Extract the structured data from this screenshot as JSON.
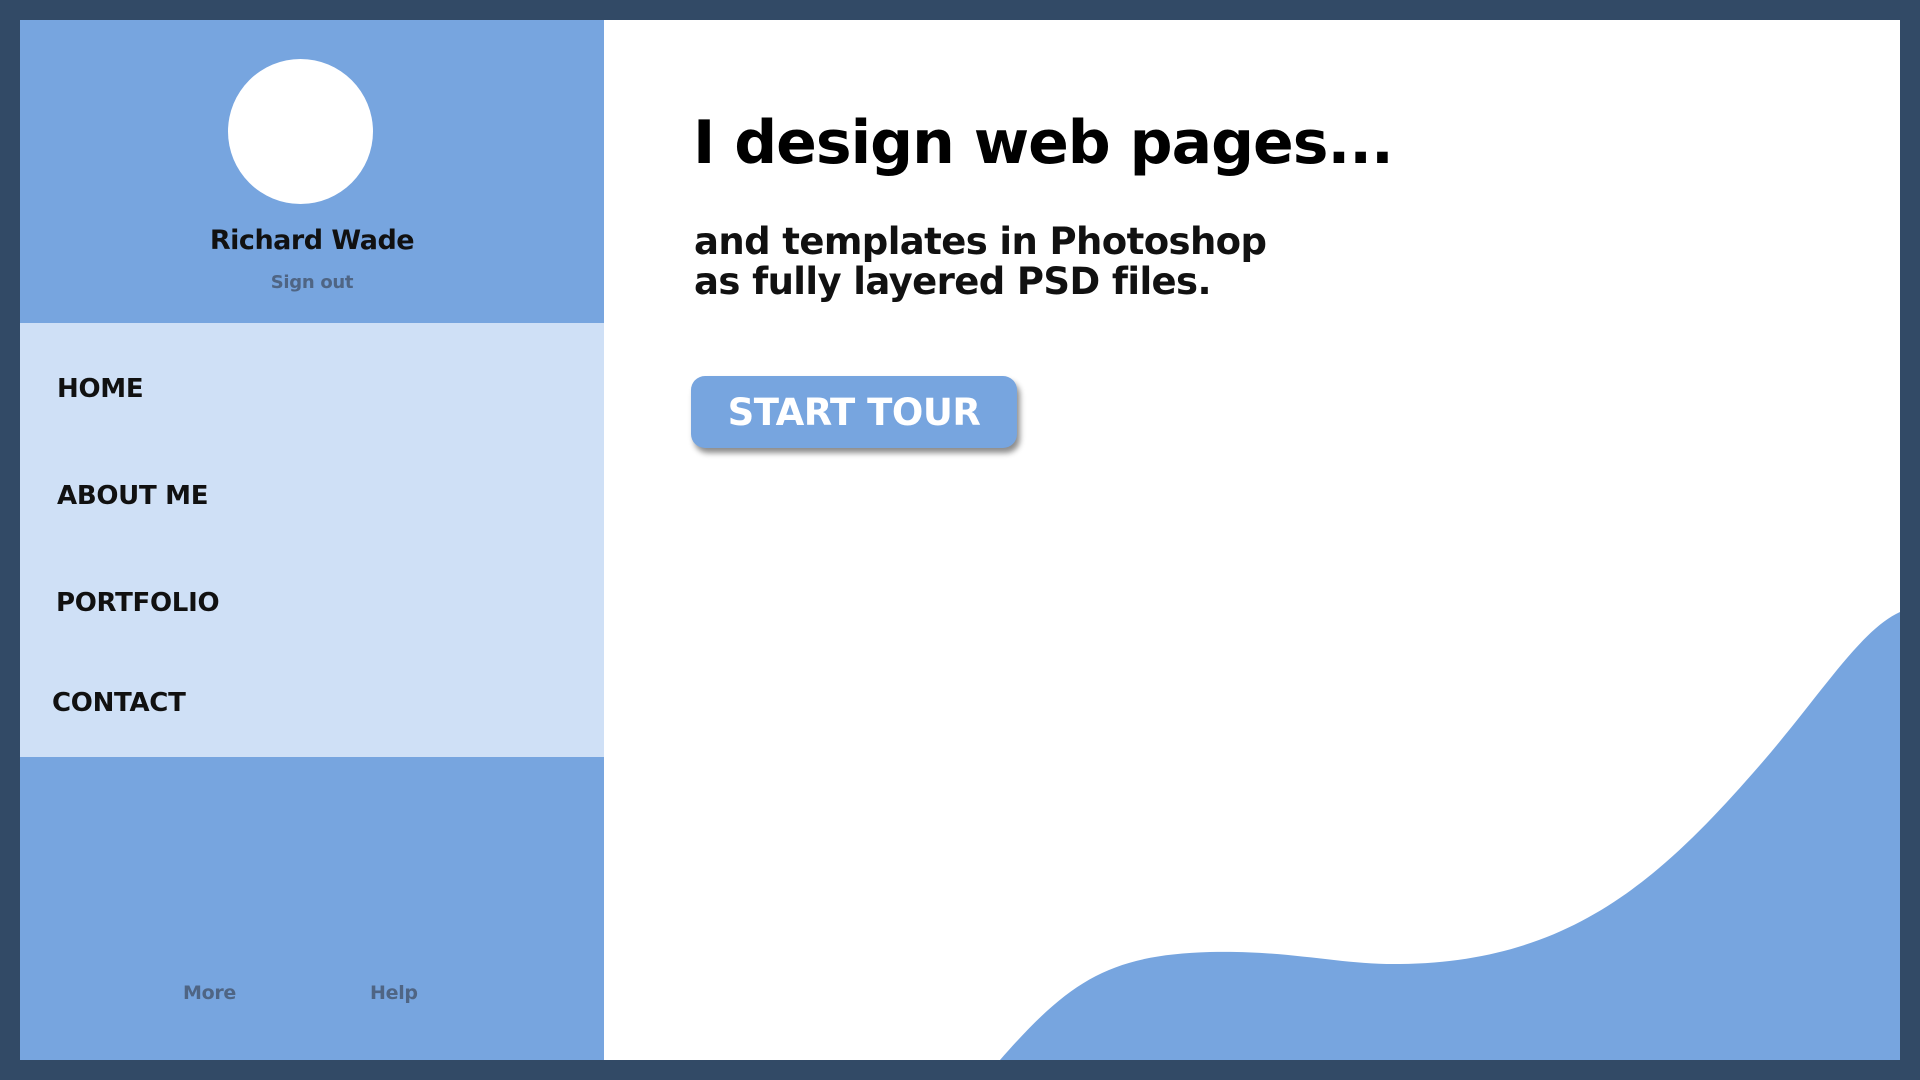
{
  "colors": {
    "outer_border": "#324a66",
    "sidebar_accent": "#77a5df",
    "nav_background": "#cfe0f6",
    "content_background": "#ffffff",
    "muted_text": "#4f6584"
  },
  "profile": {
    "avatar_icon": "avatar-circle",
    "name": "Richard Wade",
    "sign_out_label": "Sign out"
  },
  "nav": {
    "items": [
      {
        "label": "HOME"
      },
      {
        "label": "ABOUT ME"
      },
      {
        "label": "PORTFOLIO"
      },
      {
        "label": "CONTACT"
      }
    ]
  },
  "sidebar_footer": {
    "more_label": "More",
    "help_label": "Help"
  },
  "main": {
    "heading": "I design web pages...",
    "subheading_line1": "and templates in Photoshop",
    "subheading_line2": "as fully layered PSD files.",
    "cta_label": "START TOUR"
  }
}
